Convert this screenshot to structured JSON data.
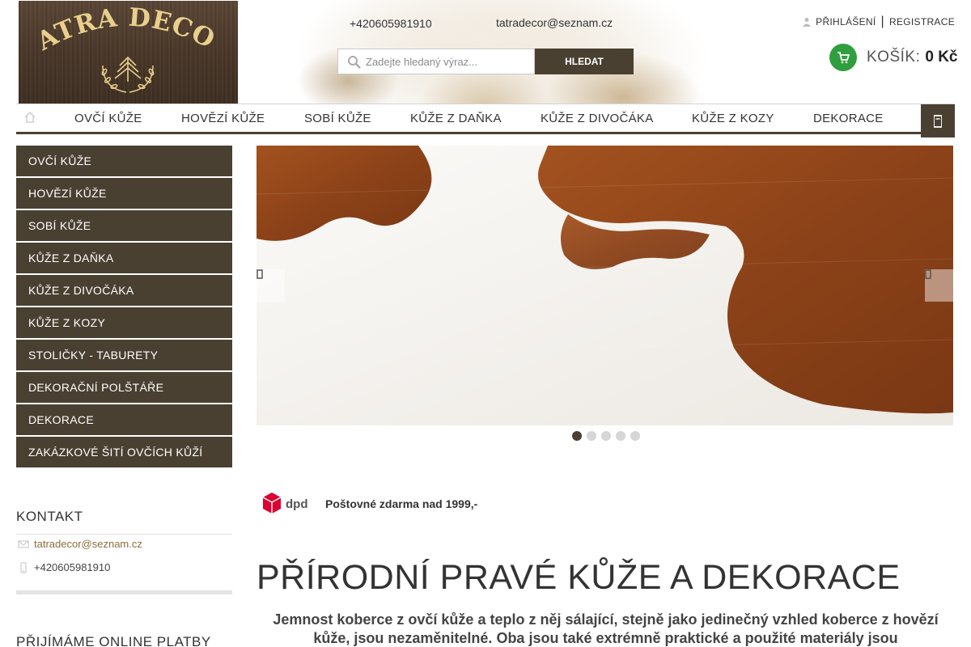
{
  "header": {
    "logo_text": "TATRA DECOR",
    "phone": "+420605981910",
    "email": "tatradecor@seznam.cz",
    "search": {
      "placeholder": "Zadejte hledaný výraz...",
      "button_label": "HLEDAT"
    },
    "login_label": "PŘIHLÁŠENÍ",
    "separator": "|",
    "register_label": "REGISTRACE",
    "cart": {
      "label": "KOŠÍK:",
      "price": "0 Kč",
      "accent": "#2e9e3e"
    }
  },
  "topnav": {
    "items": [
      {
        "label": "OVČÍ KŮŽE"
      },
      {
        "label": "HOVĚZÍ KŮŽE"
      },
      {
        "label": "SOBÍ KŮŽE"
      },
      {
        "label": "KŮŽE Z DAŇKA"
      },
      {
        "label": "KŮŽE Z DIVOČÁKA"
      },
      {
        "label": "KŮŽE Z KOZY"
      },
      {
        "label": "DEKORACE"
      }
    ],
    "accent": "#4a4032"
  },
  "sidenav": {
    "items": [
      {
        "label": "OVČÍ KŮŽE"
      },
      {
        "label": "HOVĚZÍ KŮŽE"
      },
      {
        "label": "SOBÍ KŮŽE"
      },
      {
        "label": "KŮŽE Z DAŇKA"
      },
      {
        "label": "KŮŽE Z DIVOČÁKA"
      },
      {
        "label": "KŮŽE Z KOZY"
      },
      {
        "label": "STOLIČKY - TABURETY"
      },
      {
        "label": "DEKORAČNÍ POLŠTÁŘE"
      },
      {
        "label": "DEKORACE"
      },
      {
        "label": "ZAKÁZKOVÉ ŠITÍ OVČÍCH KŮŽÍ"
      }
    ]
  },
  "kontakt": {
    "title": "KONTAKT",
    "email": "tatradecor@seznam.cz",
    "phone": "+420605981910"
  },
  "payments_title": "PŘIJÍMÁME ONLINE PLATBY",
  "slider": {
    "slide_count": 5,
    "active_index": 0
  },
  "shipping": {
    "text": "Poštovné zdarma nad 1999,-",
    "carrier": "dpd"
  },
  "main": {
    "title": "PŘÍRODNÍ PRAVÉ KŮŽE A DEKORACE",
    "intro": "Jemnost koberce z ovčí kůže a teplo z něj sálající, stejně jako jedinečný vzhled koberce z hovězí kůže, jsou nezaměnitelné. Oba jsou také extrémně praktické a použité materiály jsou"
  }
}
